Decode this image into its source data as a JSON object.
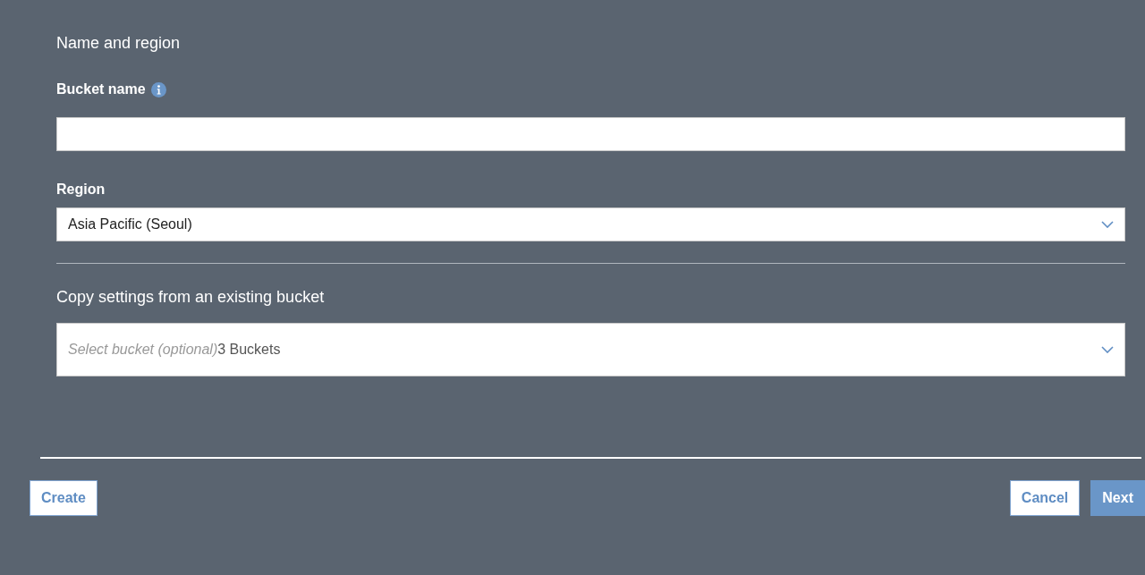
{
  "section_title": "Name and region",
  "bucket_name": {
    "label": "Bucket name",
    "info": true
  },
  "region": {
    "label": "Region",
    "value": "Asia Pacific (Seoul)"
  },
  "copy_settings": {
    "title": "Copy settings from an existing bucket",
    "placeholder": "Select bucket (optional)",
    "count": "3 Buckets"
  },
  "footer": {
    "left_buttons": [
      {
        "label": "Create",
        "kind": "secondary"
      }
    ],
    "right_buttons": [
      {
        "label": "Cancel",
        "kind": "secondary"
      },
      {
        "label": "Next",
        "kind": "primary"
      }
    ]
  }
}
